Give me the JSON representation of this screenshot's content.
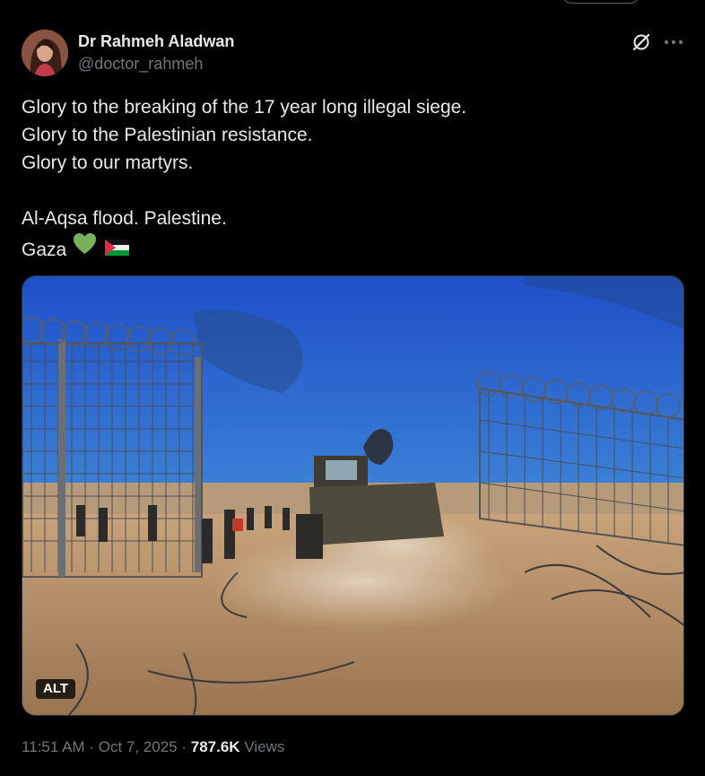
{
  "author": {
    "display_name": "Dr Rahmeh Aladwan",
    "handle": "@doctor_rahmeh",
    "avatar_icon": "profile-photo"
  },
  "post": {
    "lines": [
      "Glory to the breaking of the 17 year long illegal siege.",
      "Glory to the Palestinian resistance.",
      "Glory to our martyrs.",
      "",
      "Al-Aqsa flood. Palestine."
    ],
    "last_line_text": "Gaza",
    "emojis": [
      "green-heart",
      "palestine-flag"
    ]
  },
  "media": {
    "alt_label": "ALT"
  },
  "meta": {
    "time": "11:51 AM",
    "separator": "·",
    "date": "Oct 7, 2025",
    "views_count": "787.6K",
    "views_label": "Views"
  },
  "icons": {
    "grok": "grok-icon",
    "more": "more-icon"
  },
  "colors": {
    "background": "#000000",
    "primary_text": "#e7e9ea",
    "secondary_text": "#71767b",
    "border": "#2f3336"
  }
}
